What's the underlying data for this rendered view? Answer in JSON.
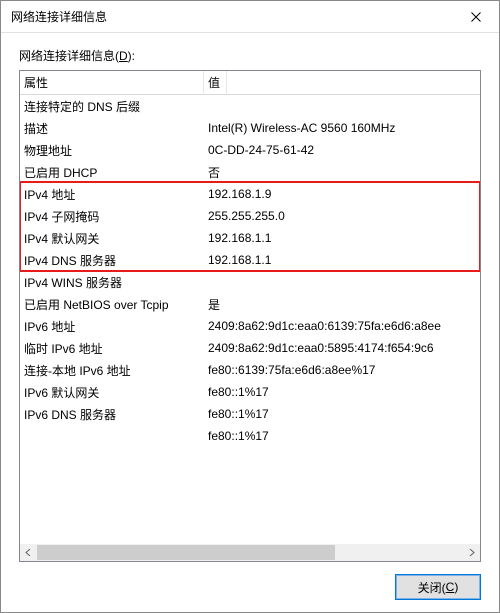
{
  "window": {
    "title": "网络连接详细信息"
  },
  "label": {
    "text": "网络连接详细信息(",
    "key": "D",
    "suffix": "):"
  },
  "headers": {
    "property": "属性",
    "value": "值"
  },
  "rows": [
    {
      "prop": "连接特定的 DNS 后缀",
      "val": ""
    },
    {
      "prop": "描述",
      "val": "Intel(R) Wireless-AC 9560 160MHz"
    },
    {
      "prop": "物理地址",
      "val": "0C-DD-24-75-61-42"
    },
    {
      "prop": "已启用 DHCP",
      "val": "否"
    },
    {
      "prop": "IPv4 地址",
      "val": "192.168.1.9"
    },
    {
      "prop": "IPv4 子网掩码",
      "val": "255.255.255.0"
    },
    {
      "prop": "IPv4 默认网关",
      "val": "192.168.1.1"
    },
    {
      "prop": "IPv4 DNS 服务器",
      "val": "192.168.1.1"
    },
    {
      "prop": "IPv4 WINS 服务器",
      "val": ""
    },
    {
      "prop": "已启用 NetBIOS over Tcpip",
      "val": "是"
    },
    {
      "prop": "IPv6 地址",
      "val": "2409:8a62:9d1c:eaa0:6139:75fa:e6d6:a8ee"
    },
    {
      "prop": "临时 IPv6 地址",
      "val": "2409:8a62:9d1c:eaa0:5895:4174:f654:9c6"
    },
    {
      "prop": "连接-本地 IPv6 地址",
      "val": "fe80::6139:75fa:e6d6:a8ee%17"
    },
    {
      "prop": "IPv6 默认网关",
      "val": "fe80::1%17"
    },
    {
      "prop": "IPv6 DNS 服务器",
      "val": "fe80::1%17"
    },
    {
      "prop": "",
      "val": "fe80::1%17"
    }
  ],
  "highlight": {
    "from": 4,
    "to": 7
  },
  "button": {
    "close_prefix": "关闭(",
    "close_key": "C",
    "close_suffix": ")"
  }
}
